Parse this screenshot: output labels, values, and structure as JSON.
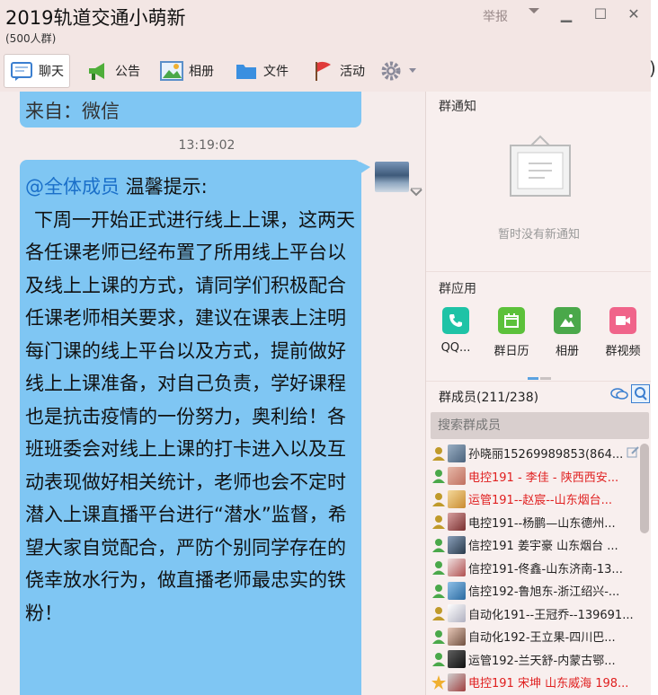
{
  "window": {
    "title": "2019轨道交通小萌新",
    "subtitle": "(500人群)",
    "report_label": "举报",
    "minimize": "▁",
    "maximize": "☐",
    "close": "✕"
  },
  "toolbar": {
    "tabs": [
      {
        "label": "聊天",
        "icon": "chat-icon"
      },
      {
        "label": "公告",
        "icon": "megaphone-icon"
      },
      {
        "label": "相册",
        "icon": "photo-icon"
      },
      {
        "label": "文件",
        "icon": "folder-icon"
      },
      {
        "label": "活动",
        "icon": "flag-icon"
      }
    ],
    "settings_icon": "gear-icon"
  },
  "chat": {
    "prev_message": "来自：微信",
    "timestamp": "13:19:02",
    "message": {
      "mention": "@全体成员",
      "heading": " 温馨提示:",
      "body": "下周一开始正式进行线上上课，这两天各任课老师已经布置了所用线上平台以及线上上课的方式，请同学们积极配合任课老师相关要求，建议在课表上注明每门课的线上平台以及方式，提前做好线上上课准备，对自己负责，学好课程也是抗击疫情的一份努力，奥利给！各班班委会对线上上课的打卡进入以及互动表现做好相关统计，老师也会不定时潜入上课直播平台进行“潜水”监督，希望大家自觉配合，严防个别同学存在的侥幸放水行为，做直播老师最忠实的铁粉！"
    }
  },
  "panel": {
    "notice_title": "群通知",
    "notice_empty": "暂时没有新通知",
    "apps_title": "群应用",
    "apps": [
      {
        "label": "QQ...",
        "icon": "phone-icon",
        "color": "#1ec3a6"
      },
      {
        "label": "群日历",
        "icon": "calendar-icon",
        "color": "#5cc13a"
      },
      {
        "label": "相册",
        "icon": "album-icon",
        "color": "#4aa84a"
      },
      {
        "label": "群视频",
        "icon": "video-icon",
        "color": "#f0648a"
      }
    ],
    "members_title": "群成员(211/238)",
    "search_placeholder": "搜索群成员",
    "members": [
      {
        "name": "孙晓丽15269989853(864...",
        "color": "#222"
      },
      {
        "name": "电控191 - 李佳 - 陕西西安...",
        "color": "#e02020"
      },
      {
        "name": "运管191--赵宸--山东烟台...",
        "color": "#e02020"
      },
      {
        "name": "电控191--杨鹏—山东德州...",
        "color": "#222"
      },
      {
        "name": "信控191 姜宇豪 山东烟台 ...",
        "color": "#222"
      },
      {
        "name": "信控191-佟鑫-山东济南-13...",
        "color": "#222"
      },
      {
        "name": "信控192-鲁旭东-浙江绍兴-...",
        "color": "#222"
      },
      {
        "name": "自动化191--王冠乔--139691...",
        "color": "#222"
      },
      {
        "name": "自动化192-王立果-四川巴...",
        "color": "#222"
      },
      {
        "name": "运管192-兰天舒-内蒙古鄂...",
        "color": "#222"
      },
      {
        "name": "电控191 宋坤 山东威海 198...",
        "color": "#e02020"
      }
    ]
  }
}
